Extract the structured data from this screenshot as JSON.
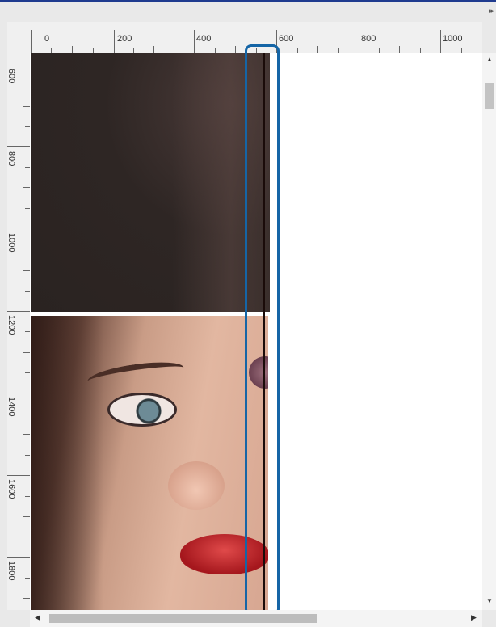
{
  "window": {
    "panel_toggle_icon": "double-chevron-right-icon",
    "panel_toggle_glyph": "▸▸"
  },
  "ruler_top": {
    "labels": [
      "0",
      "200",
      "400",
      "600",
      "800",
      "1000"
    ]
  },
  "ruler_left": {
    "labels": [
      "600",
      "800",
      "1000",
      "1200",
      "1400",
      "1600",
      "1800"
    ]
  },
  "canvas": {
    "highlight_color": "#1565a6",
    "guide_color": "#1a0b09"
  },
  "scrollbars": {
    "up_glyph": "▲",
    "down_glyph": "▼",
    "left_glyph": "◀",
    "right_glyph": "▶"
  }
}
